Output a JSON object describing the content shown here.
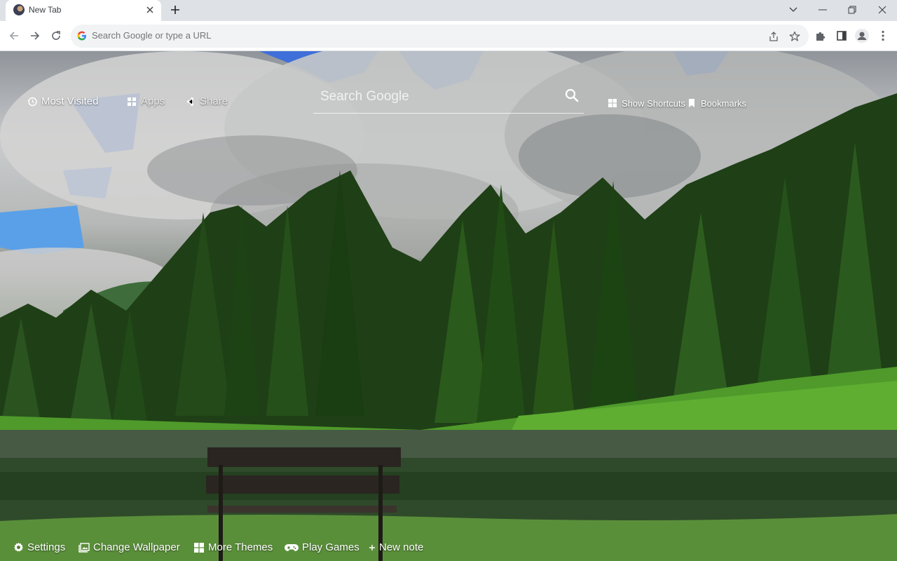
{
  "browser": {
    "tab_title": "New Tab",
    "omnibox_placeholder": "Search Google or type a URL"
  },
  "ntp": {
    "top_left": {
      "most_visited": "Most Visited",
      "apps": "Apps",
      "share": "Share"
    },
    "search_placeholder": "Search Google",
    "top_right": {
      "show_shortcuts": "Show Shortcuts",
      "bookmarks": "Bookmarks"
    },
    "bottom_bar": {
      "settings": "Settings",
      "change_wallpaper": "Change Wallpaper",
      "more_themes": "More Themes",
      "play_games": "Play Games",
      "new_note": "New note"
    }
  },
  "colors": {
    "tabstrip": "#dee1e6",
    "toolbar": "#ffffff",
    "omnibox": "#f1f3f4",
    "icon_gray": "#5f6368"
  },
  "icons": [
    "close-icon",
    "plus-icon",
    "chevron-down-icon",
    "minimize-icon",
    "restore-icon",
    "back-arrow-icon",
    "forward-arrow-icon",
    "reload-icon",
    "google-g-icon",
    "share-icon",
    "star-icon",
    "puzzle-icon",
    "side-panel-icon",
    "profile-icon",
    "kebab-menu-icon",
    "history-icon",
    "grid-icon",
    "search-icon",
    "windows-grid-icon",
    "bookmark-icon",
    "gear-icon",
    "image-icon",
    "gamepad-icon"
  ]
}
